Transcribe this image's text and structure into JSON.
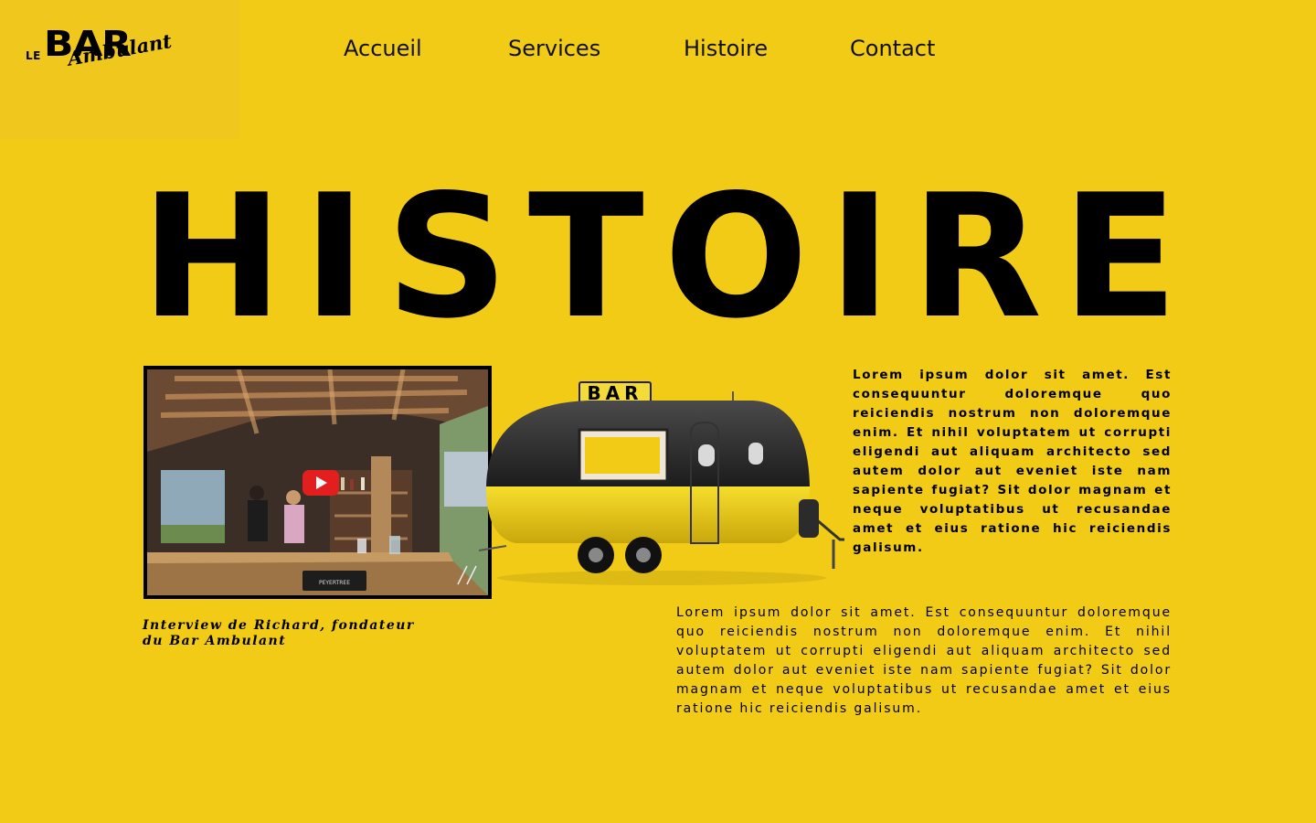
{
  "logo": {
    "le": "LE",
    "bar": "BAR",
    "ambulant": "Ambulant"
  },
  "nav": {
    "items": [
      {
        "label": "Accueil"
      },
      {
        "label": "Services"
      },
      {
        "label": "Histoire"
      },
      {
        "label": "Contact"
      }
    ]
  },
  "hero": {
    "title_letters": [
      "H",
      "I",
      "S",
      "T",
      "O",
      "I",
      "R",
      "E"
    ]
  },
  "video": {
    "caption": "Interview de Richard, fondateur du Bar Ambulant",
    "play_icon": "youtube-play-icon",
    "sign_text": "PEYERTREE"
  },
  "trailer": {
    "sign": "BAR"
  },
  "text": {
    "bold": "Lorem ipsum dolor sit amet. Est consequuntur doloremque quo reiciendis nostrum non doloremque enim. Et nihil voluptatem ut corrupti eligendi aut aliquam architecto sed autem dolor aut eveniet iste nam sapiente fugiat? Sit dolor magnam et neque voluptatibus ut recusandae amet et eius ratione hic reiciendis galisum.",
    "light": "Lorem ipsum dolor sit amet. Est consequuntur doloremque quo reiciendis nostrum non doloremque enim. Et nihil voluptatem ut corrupti eligendi aut aliquam architecto sed autem dolor aut eveniet iste nam sapiente fugiat? Sit dolor magnam et neque voluptatibus ut recusandae amet et eius ratione hic reiciendis galisum."
  },
  "colors": {
    "background": "#F2CB16",
    "text": "#000000",
    "youtube_red": "#E21E1E"
  }
}
